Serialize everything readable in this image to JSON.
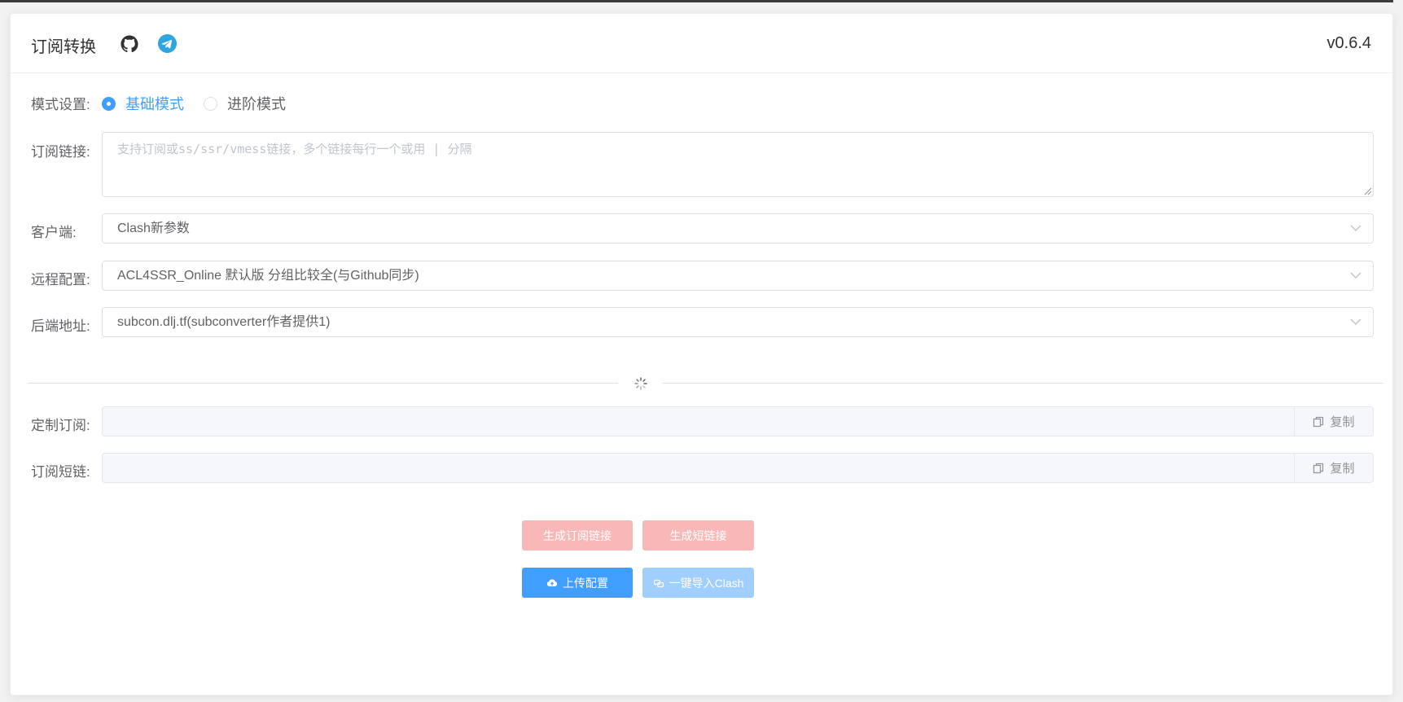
{
  "header": {
    "title": "订阅转换",
    "version": "v0.6.4",
    "icons": [
      "github-icon",
      "telegram-icon"
    ]
  },
  "form": {
    "mode": {
      "label": "模式设置:",
      "options": [
        {
          "label": "基础模式",
          "checked": true
        },
        {
          "label": "进阶模式",
          "checked": false
        }
      ]
    },
    "subscription": {
      "label": "订阅链接:",
      "placeholder": "支持订阅或ss/ssr/vmess链接，多个链接每行一个或用 | 分隔",
      "value": ""
    },
    "client": {
      "label": "客户端:",
      "value": "Clash新参数"
    },
    "remote_config": {
      "label": "远程配置:",
      "value": "ACL4SSR_Online 默认版 分组比较全(与Github同步)"
    },
    "backend": {
      "label": "后端地址:",
      "value": "subcon.dlj.tf(subconverter作者提供1)"
    }
  },
  "output": {
    "custom_sub": {
      "label": "定制订阅:",
      "value": "",
      "copy_label": "复制"
    },
    "short_link": {
      "label": "订阅短链:",
      "value": "",
      "copy_label": "复制"
    }
  },
  "actions": {
    "generate_sub": "生成订阅链接",
    "generate_short": "生成短链接",
    "upload_config": "上传配置",
    "import_clash": "一键导入Clash"
  },
  "colors": {
    "primary": "#409eff",
    "primary_disabled": "#a0cfff",
    "danger_disabled": "#f9b8b8"
  }
}
